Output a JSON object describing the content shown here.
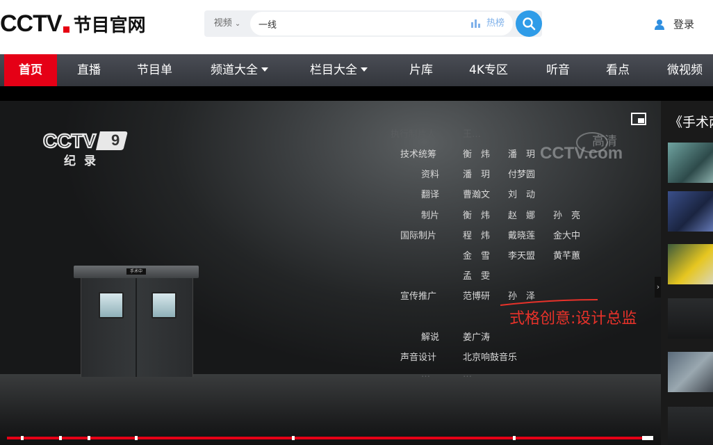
{
  "header": {
    "logo_text": "CCTV",
    "logo_sub": "节目官网",
    "search_category": "视频",
    "search_value": "一线",
    "hot_label": "热榜",
    "login_label": "登录"
  },
  "nav": {
    "items": [
      {
        "label": "首页",
        "active": true
      },
      {
        "label": "直播"
      },
      {
        "label": "节目单"
      },
      {
        "label": "频道大全",
        "dropdown": true
      },
      {
        "label": "栏目大全",
        "dropdown": true
      },
      {
        "label": "片库"
      },
      {
        "label": "4K专区"
      },
      {
        "label": "听音"
      },
      {
        "label": "看点"
      },
      {
        "label": "微视频"
      }
    ]
  },
  "player": {
    "channel_number": "9",
    "channel_name": "纪录",
    "door_sign": "手术中",
    "watermark": "CCTV.com",
    "watermark_sub": "高清",
    "annotation": "式格创意:设计总监",
    "credits": [
      {
        "role": "执行制片人",
        "names": "王…",
        "faded": true
      },
      {
        "role": "技术统筹",
        "names": "衡　炜　　潘　玥"
      },
      {
        "role": "资料",
        "names": "潘　玥　　付梦圆"
      },
      {
        "role": "翻译",
        "names": "曹瀚文　　刘　动"
      },
      {
        "role": "制片",
        "names": "衡　炜　　赵　娜　　孙　亮"
      },
      {
        "role": "国际制片",
        "names": "程　炜　　戴晓莲　　金大中"
      },
      {
        "role": "",
        "names": "金　雪　　李天盟　　黄芊蕙"
      },
      {
        "role": "",
        "names": "孟　雯"
      },
      {
        "role": "宣传推广",
        "names": "范博研　　孙　泽"
      },
      {
        "role": "解说",
        "names": "姜广涛"
      },
      {
        "role": "声音设计",
        "names": "北京响鼓音乐"
      },
      {
        "role": "…",
        "names": "…",
        "faded": true
      }
    ],
    "progress": 1.0
  },
  "sidebar": {
    "title": "《手术两"
  },
  "colors": {
    "brand_red": "#e50016",
    "search_blue": "#2f9ce8",
    "annotation_red": "#e8322a"
  }
}
